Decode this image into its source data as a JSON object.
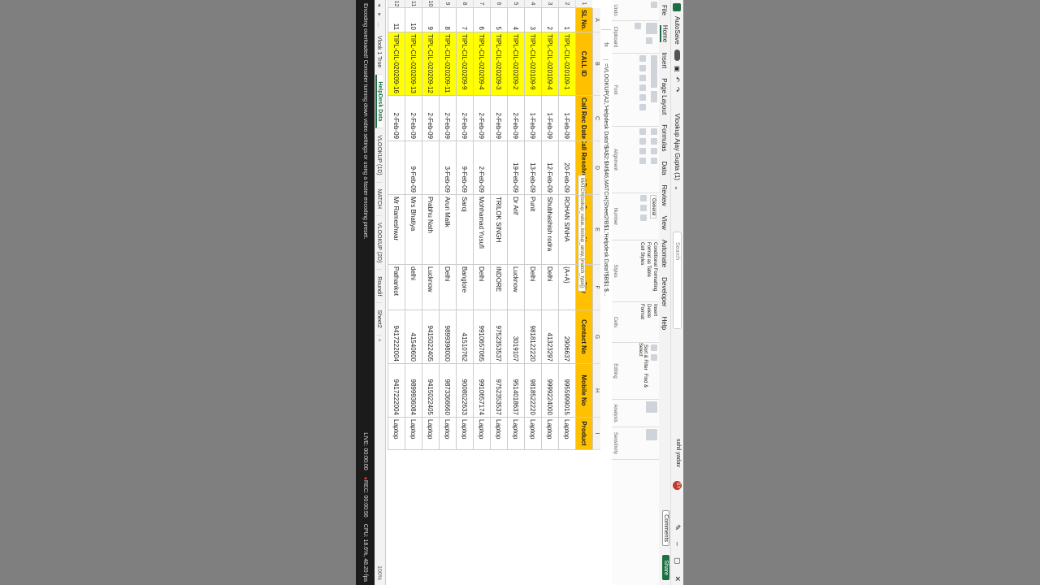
{
  "title": {
    "autosave": "AutoSave",
    "filename": "Vlookup Ajay Gupta (1)",
    "search": "Search",
    "user": "sahil yadav"
  },
  "menu": [
    "File",
    "Home",
    "Insert",
    "Page Layout",
    "Formulas",
    "Data",
    "Review",
    "View",
    "Automate",
    "Developer",
    "Help"
  ],
  "buttons": {
    "comments": "Comments",
    "share": "Share"
  },
  "ribbon_groups": [
    "Undo",
    "Clipboard",
    "Font",
    "Alignment",
    "Number",
    "Styles",
    "Cells",
    "Editing",
    "Analysis",
    "Sensitivity"
  ],
  "ribbon_labels": {
    "cond": "Conditional Formatting",
    "fmt_table": "Format as Table",
    "cell_styles": "Cell Styles",
    "insert": "Insert",
    "delete": "Delete",
    "format": "Format",
    "sort": "Sort & Filter",
    "find": "Find & Select",
    "general": "General"
  },
  "formula": {
    "fx": "fx",
    "text": "=VLOOKUP(A2,'Helpdesk Data'!$A$2:$M$46,MATCH(Sheet2!B$1,'Helpdesk Data'!$B$1:$..."
  },
  "tooltip": "MATCH(lookup_value, lookup_array, [match_type])",
  "columns": [
    "A",
    "B",
    "C",
    "D",
    "E",
    "F",
    "G",
    "H",
    "I"
  ],
  "headers": [
    "SL No.",
    "CALL ID",
    "Call Rec Date",
    "Call Resolved Date",
    "Customer Name",
    "City",
    "Contact No",
    "Mobile No",
    "Product"
  ],
  "rows": [
    [
      "1",
      "TIPL-CIL-020109-1",
      "1-Feb-09",
      "20-Feb-09",
      "ROHAN SINHA",
      "{A+A}",
      "2906637",
      "9955999015",
      "Laptop"
    ],
    [
      "2",
      "TIPL-CIL-020109-4",
      "1-Feb-09",
      "12-Feb-09",
      "Shubhashish rodra",
      "Delhi",
      "41323297",
      "9999224000",
      "Laptop"
    ],
    [
      "3",
      "TIPL-CIL-020109-9",
      "1-Feb-09",
      "13-Feb-09",
      "Punit",
      "Delhi",
      "9818122220",
      "9818522220",
      "Laptop"
    ],
    [
      "4",
      "TIPL-CIL-020209-2",
      "2-Feb-09",
      "19-Feb-09",
      "Dr Arif",
      "Lucknow",
      "3019107",
      "9514018637",
      "Laptop"
    ],
    [
      "5",
      "TIPL-CIL-020209-3",
      "2-Feb-09",
      "",
      "TRILOK SINGH",
      "INDORE",
      "9752353537",
      "9752353537",
      "Laptop"
    ],
    [
      "6",
      "TIPL-CIL-020209-4",
      "2-Feb-09",
      "2-Feb-09",
      "Mohhamad Yusufi",
      "Delhi",
      "9910657065",
      "9910657174",
      "Laptop"
    ],
    [
      "7",
      "TIPL-CIL-020209-9",
      "2-Feb-09",
      "9-Feb-09",
      "Saroj",
      "Banglore",
      "41510762",
      "9008022633",
      "Laptop"
    ],
    [
      "8",
      "TIPL-CIL-020209-11",
      "2-Feb-09",
      "3-Feb-09",
      "Arun Malik",
      "Delhi",
      "9899398000",
      "9873366660",
      "Laptop"
    ],
    [
      "9",
      "TIPL-CIL-020209-12",
      "2-Feb-09",
      "",
      "Prabhu Nath",
      "Lucknow",
      "9415022405",
      "9415022405",
      "Laptop"
    ],
    [
      "10",
      "TIPL-CIL-020209-13",
      "2-Feb-09",
      "9-Feb-09",
      "Mrs Bhatiya",
      "delhi",
      "41540600",
      "9899936084",
      "Laptop"
    ],
    [
      "11",
      "TIPL-CIL-020209-16",
      "2-Feb-09",
      "",
      "Mr Rameshwar",
      "Pathankot",
      "9417222004",
      "9417222004",
      "Laptop"
    ]
  ],
  "row_numbers": [
    "1",
    "2",
    "3",
    "4",
    "5",
    "6",
    "7",
    "8",
    "9",
    "10",
    "11",
    "12"
  ],
  "sheets": [
    "Vlook 1 True",
    "HelpDesk Data",
    "VLOOKUP (1D)",
    "MATCH",
    "VLOOKUP (2D)",
    "Roundif",
    "Sheet2"
  ],
  "active_sheet": "HelpDesk Data",
  "status": {
    "warn": "Encoding overloaded! Consider turning down video settings or using a faster encoding preset.",
    "live": "LIVE: 00:00:00",
    "rec": "REC: 00:00:56",
    "cpu": "CPU: 18.6%, 48.20 fps",
    "zoom": "100%"
  },
  "colors": {
    "header": "#ffc000",
    "highlight": "#ffff00",
    "accent": "#1d6f42"
  }
}
